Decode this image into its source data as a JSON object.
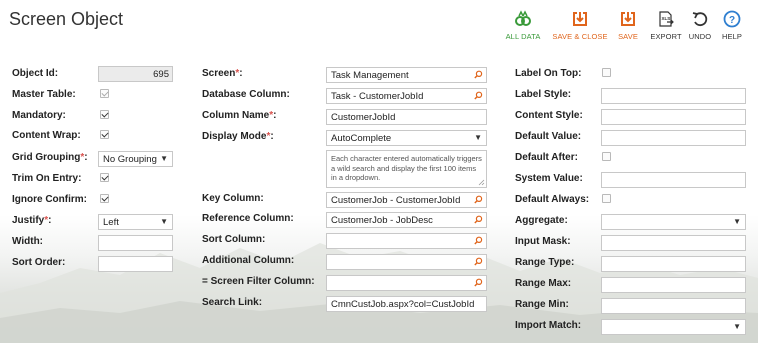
{
  "page": {
    "title": "Screen Object"
  },
  "toolbar": {
    "all_data": "ALL DATA",
    "save_close": "SAVE & CLOSE",
    "save": "SAVE",
    "export": "EXPORT",
    "undo": "UNDO",
    "help": "HELP"
  },
  "col1": {
    "object_id": {
      "label": "Object Id:",
      "value": "695"
    },
    "master_table": {
      "label": "Master Table:",
      "checked": true
    },
    "mandatory": {
      "label": "Mandatory:",
      "checked": true
    },
    "content_wrap": {
      "label": "Content Wrap:",
      "checked": true
    },
    "grid_grouping": {
      "label": "Grid Grouping",
      "req": "*",
      "colon": ":",
      "value": "No Grouping"
    },
    "trim_on_entry": {
      "label": "Trim On Entry:",
      "checked": true
    },
    "ignore_confirm": {
      "label": "Ignore Confirm:",
      "checked": true
    },
    "justify": {
      "label": "Justify",
      "req": "*",
      "colon": ":",
      "value": "Left"
    },
    "width": {
      "label": "Width:",
      "value": ""
    },
    "sort_order": {
      "label": "Sort Order:",
      "value": ""
    }
  },
  "col2": {
    "screen": {
      "label": "Screen",
      "req": "*",
      "colon": ":",
      "value": "Task Management"
    },
    "database_column": {
      "label": "Database Column:",
      "value": "Task - CustomerJobId"
    },
    "column_name": {
      "label": "Column Name",
      "req": "*",
      "colon": ":",
      "value": "CustomerJobId"
    },
    "display_mode": {
      "label": "Display Mode",
      "req": "*",
      "colon": ":",
      "value": "AutoComplete"
    },
    "display_mode_help": "Each character entered automatically triggers a wild search and display the first 100 items in a dropdown.",
    "key_column": {
      "label": "Key Column:",
      "value": "CustomerJob - CustomerJobId"
    },
    "reference_column": {
      "label": "Reference Column:",
      "value": "CustomerJob - JobDesc"
    },
    "sort_column": {
      "label": "Sort Column:",
      "value": ""
    },
    "additional_column": {
      "label": "Additional Column:",
      "value": ""
    },
    "screen_filter_column": {
      "label": "= Screen Filter Column:",
      "value": ""
    },
    "search_link": {
      "label": "Search Link:",
      "value": "CmnCustJob.aspx?col=CustJobId"
    }
  },
  "col3": {
    "label_on_top": {
      "label": "Label On Top:",
      "checked": false
    },
    "label_style": {
      "label": "Label Style:",
      "value": ""
    },
    "content_style": {
      "label": "Content Style:",
      "value": ""
    },
    "default_value": {
      "label": "Default Value:",
      "value": ""
    },
    "default_after": {
      "label": "Default After:",
      "checked": false
    },
    "system_value": {
      "label": "System Value:",
      "value": ""
    },
    "default_always": {
      "label": "Default Always:",
      "checked": false
    },
    "aggregate": {
      "label": "Aggregate:",
      "value": ""
    },
    "input_mask": {
      "label": "Input Mask:",
      "value": ""
    },
    "range_type": {
      "label": "Range Type:",
      "value": ""
    },
    "range_max": {
      "label": "Range Max:",
      "value": ""
    },
    "range_min": {
      "label": "Range Min:",
      "value": ""
    },
    "import_match": {
      "label": "Import Match:",
      "value": ""
    }
  },
  "colors": {
    "required": "#d9534f",
    "accent_orange": "#e0651c",
    "accent_green": "#3a9a3a",
    "help_blue": "#2f7fd0"
  }
}
